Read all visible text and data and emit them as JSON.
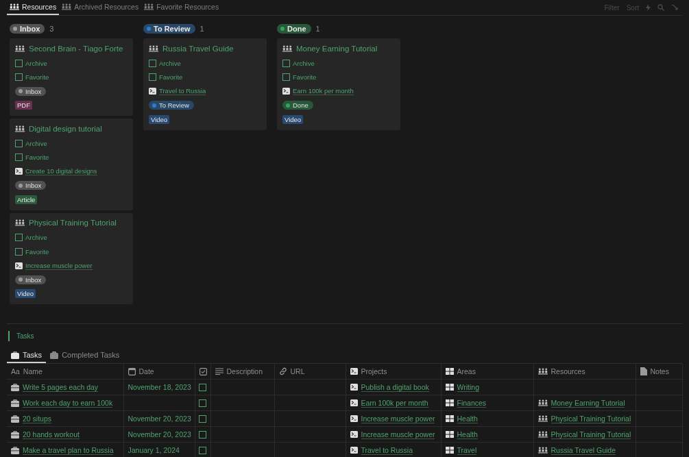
{
  "view_tabs": [
    {
      "label": "Resources",
      "selected": true
    },
    {
      "label": "Archived Resources",
      "selected": false
    },
    {
      "label": "Favorite Resources",
      "selected": false
    }
  ],
  "toolbar": {
    "buttons": [
      "Filter",
      "Sort"
    ]
  },
  "board": {
    "groups": [
      {
        "status": "Inbox",
        "color": "#9b9b9b",
        "count": "3",
        "cards": [
          {
            "title": "Second Brain - Tiago Forte",
            "fields": [
              {
                "kind": "checkbox",
                "label": "Archive",
                "checked": false
              },
              {
                "kind": "checkbox",
                "label": "Favorite",
                "checked": false
              },
              {
                "kind": "status",
                "label": "Inbox",
                "color": "#9b9b9b"
              },
              {
                "kind": "tag",
                "label": "PDF",
                "color": "#69314f"
              }
            ]
          },
          {
            "title": "Digital design tutorial",
            "fields": [
              {
                "kind": "checkbox",
                "label": "Archive",
                "checked": false
              },
              {
                "kind": "checkbox",
                "label": "Favorite",
                "checked": false
              },
              {
                "kind": "project",
                "label": "Create 10 digital designs"
              },
              {
                "kind": "status",
                "label": "Inbox",
                "color": "#9b9b9b"
              },
              {
                "kind": "tag",
                "label": "Article",
                "color": "#2b5b3c"
              }
            ]
          },
          {
            "title": "Physical Training Tutorial",
            "fields": [
              {
                "kind": "checkbox",
                "label": "Archive",
                "checked": false
              },
              {
                "kind": "checkbox",
                "label": "Favorite",
                "checked": false
              },
              {
                "kind": "project",
                "label": "Increase muscle power"
              },
              {
                "kind": "status",
                "label": "Inbox",
                "color": "#9b9b9b"
              },
              {
                "kind": "tag",
                "label": "Video",
                "color": "#284a70"
              }
            ]
          }
        ]
      },
      {
        "status": "To Review",
        "color": "#2e7cd1",
        "count": "1",
        "cards": [
          {
            "title": "Russia Travel Guide",
            "fields": [
              {
                "kind": "checkbox",
                "label": "Archive",
                "checked": false
              },
              {
                "kind": "checkbox",
                "label": "Favorite",
                "checked": false
              },
              {
                "kind": "project",
                "label": "Travel to Russia"
              },
              {
                "kind": "status",
                "label": "To Review",
                "color": "#2e7cd1"
              },
              {
                "kind": "tag",
                "label": "Video",
                "color": "#284a70"
              }
            ]
          }
        ]
      },
      {
        "status": "Done",
        "color": "#2fa65a",
        "count": "1",
        "cards": [
          {
            "title": "Money Earning Tutorial",
            "fields": [
              {
                "kind": "checkbox",
                "label": "Archive",
                "checked": false
              },
              {
                "kind": "checkbox",
                "label": "Favorite",
                "checked": false
              },
              {
                "kind": "project",
                "label": "Earn 100k per month"
              },
              {
                "kind": "status",
                "label": "Done",
                "color": "#2fa65a"
              },
              {
                "kind": "tag",
                "label": "Video",
                "color": "#284a70"
              }
            ]
          }
        ]
      }
    ]
  },
  "tasks": {
    "heading": "Tasks",
    "tabs": [
      {
        "label": "Tasks",
        "selected": true
      },
      {
        "label": "Completed Tasks",
        "selected": false
      }
    ],
    "columns": [
      {
        "kind": "title",
        "icon_text": "Aa",
        "label": "Name"
      },
      {
        "kind": "date",
        "label": "Date"
      },
      {
        "kind": "checkbox"
      },
      {
        "kind": "text",
        "label": "Description"
      },
      {
        "kind": "url",
        "label": "URL"
      },
      {
        "kind": "project",
        "label": "Projects"
      },
      {
        "kind": "area",
        "label": "Areas"
      },
      {
        "kind": "resource",
        "label": "Resources"
      },
      {
        "kind": "file",
        "label": "Notes"
      }
    ],
    "rows": [
      {
        "name": "Write 5 pages each day",
        "date": "November 18, 2023",
        "done": false,
        "project": "Publish a digital book",
        "area": "Writing"
      },
      {
        "name": "Work each day to earn 100k",
        "done": false,
        "project": "Earn 100k per month",
        "area": "Finances",
        "resource": "Money Earning Tutorial"
      },
      {
        "name": "20 situps",
        "date": "November 20, 2023",
        "done": false,
        "project": "Increase muscle power",
        "area": "Health",
        "resource": "Physical Training Tutorial"
      },
      {
        "name": "20 hands workout",
        "date": "November 20, 2023",
        "done": false,
        "project": "Increase muscle power",
        "area": "Health",
        "resource": "Physical Training Tutorial"
      },
      {
        "name": "Make a travel plan to Russia",
        "date": "January 1, 2024",
        "done": false,
        "project": "Travel to Russia",
        "area": "Travel",
        "resource": "Russia Travel Guide"
      }
    ]
  }
}
